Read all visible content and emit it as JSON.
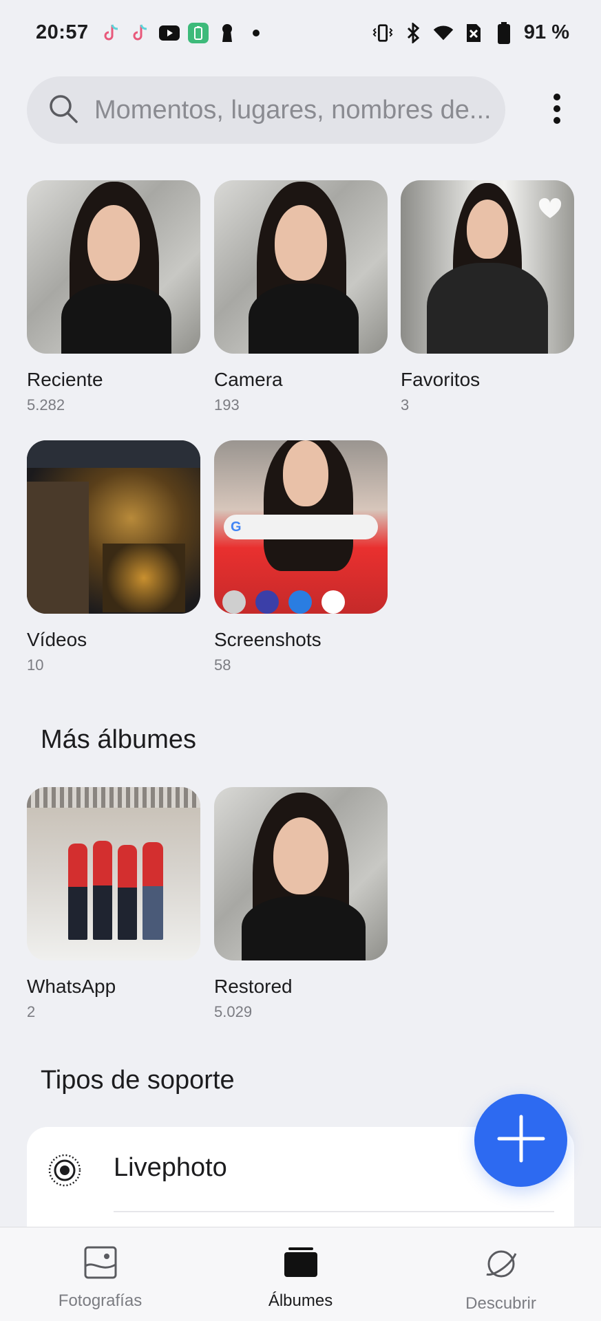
{
  "status_bar": {
    "time": "20:57",
    "battery_text": "91 %",
    "left_icons": [
      "tiktok-icon",
      "tiktok-icon",
      "youtube-icon",
      "battery-saver-icon",
      "keyhole-icon",
      "dot-icon"
    ],
    "right_icons": [
      "vibrate-icon",
      "bluetooth-icon",
      "wifi-icon",
      "no-sim-icon",
      "battery-icon"
    ]
  },
  "search": {
    "placeholder": "Momentos, lugares, nombres de..."
  },
  "albums": [
    {
      "title": "Reciente",
      "count": "5.282"
    },
    {
      "title": "Camera",
      "count": "193"
    },
    {
      "title": "Favoritos",
      "count": "3"
    },
    {
      "title": "Vídeos",
      "count": "10"
    },
    {
      "title": "Screenshots",
      "count": "58"
    }
  ],
  "more_albums": {
    "heading": "Más álbumes",
    "items": [
      {
        "title": "WhatsApp",
        "count": "2"
      },
      {
        "title": "Restored",
        "count": "5.029"
      }
    ]
  },
  "media_types": {
    "heading": "Tipos de soporte",
    "items": [
      {
        "label": "Livephoto",
        "icon": "livephoto-icon"
      }
    ]
  },
  "bottom_nav": {
    "items": [
      {
        "label": "Fotografías",
        "icon": "photos-icon",
        "active": false
      },
      {
        "label": "Álbumes",
        "icon": "albums-icon",
        "active": true
      },
      {
        "label": "Descubrir",
        "icon": "discover-icon",
        "active": false
      }
    ]
  },
  "colors": {
    "background": "#eff0f4",
    "accent": "#2d6af1",
    "search_bg": "#e2e3e8",
    "muted_text": "#7b7c82"
  }
}
